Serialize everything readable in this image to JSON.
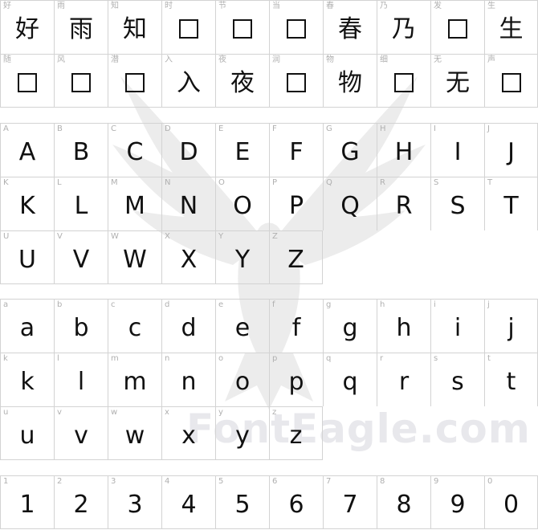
{
  "watermark": {
    "text": "FontEagle.com",
    "icon": "eagle-icon"
  },
  "cjk_rows": [
    [
      {
        "label": "好",
        "glyph": "好",
        "missing": false
      },
      {
        "label": "雨",
        "glyph": "雨",
        "missing": false
      },
      {
        "label": "知",
        "glyph": "知",
        "missing": false
      },
      {
        "label": "时",
        "glyph": "",
        "missing": true
      },
      {
        "label": "节",
        "glyph": "",
        "missing": true
      },
      {
        "label": "当",
        "glyph": "",
        "missing": true
      },
      {
        "label": "春",
        "glyph": "春",
        "missing": false
      },
      {
        "label": "乃",
        "glyph": "乃",
        "missing": false
      },
      {
        "label": "发",
        "glyph": "",
        "missing": true
      },
      {
        "label": "生",
        "glyph": "生",
        "missing": false
      }
    ],
    [
      {
        "label": "随",
        "glyph": "",
        "missing": true
      },
      {
        "label": "风",
        "glyph": "",
        "missing": true
      },
      {
        "label": "潜",
        "glyph": "",
        "missing": true
      },
      {
        "label": "入",
        "glyph": "入",
        "missing": false
      },
      {
        "label": "夜",
        "glyph": "夜",
        "missing": false
      },
      {
        "label": "润",
        "glyph": "",
        "missing": true
      },
      {
        "label": "物",
        "glyph": "物",
        "missing": false
      },
      {
        "label": "细",
        "glyph": "",
        "missing": true
      },
      {
        "label": "无",
        "glyph": "无",
        "missing": false
      },
      {
        "label": "声",
        "glyph": "",
        "missing": true
      }
    ]
  ],
  "upper_rows": [
    [
      "A",
      "B",
      "C",
      "D",
      "E",
      "F",
      "G",
      "H",
      "I",
      "J"
    ],
    [
      "K",
      "L",
      "M",
      "N",
      "O",
      "P",
      "Q",
      "R",
      "S",
      "T"
    ],
    [
      "U",
      "V",
      "W",
      "X",
      "Y",
      "Z"
    ]
  ],
  "lower_rows": [
    [
      "a",
      "b",
      "c",
      "d",
      "e",
      "f",
      "g",
      "h",
      "i",
      "j"
    ],
    [
      "k",
      "l",
      "m",
      "n",
      "o",
      "p",
      "q",
      "r",
      "s",
      "t"
    ],
    [
      "u",
      "v",
      "w",
      "x",
      "y",
      "z"
    ]
  ],
  "digit_rows": [
    [
      "1",
      "2",
      "3",
      "4",
      "5",
      "6",
      "7",
      "8",
      "9",
      "0"
    ]
  ]
}
